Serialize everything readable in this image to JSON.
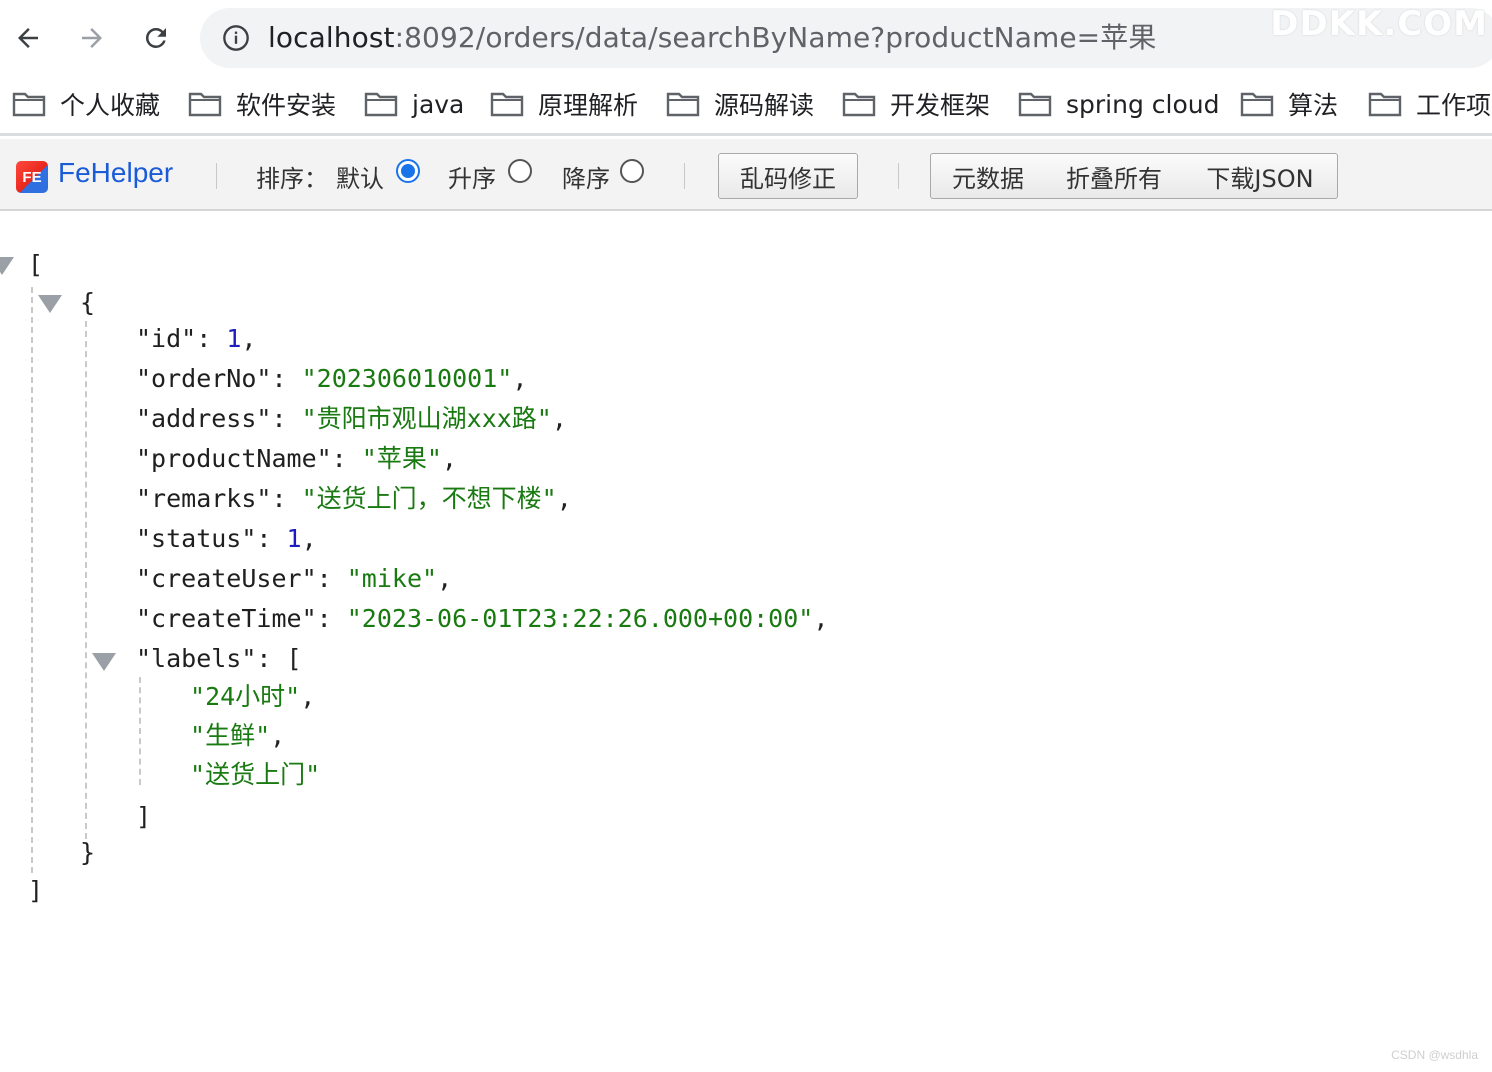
{
  "browser": {
    "url_host": "localhost",
    "url_rest": ":8092/orders/data/searchByName?productName=苹果",
    "watermark": "DDKK.COM"
  },
  "bookmarks": [
    "个人收藏",
    "软件安装",
    "java",
    "原理解析",
    "源码解读",
    "开发框架",
    "spring cloud",
    "算法",
    "工作项"
  ],
  "fehelper": {
    "logo": "FE",
    "title": "FeHelper",
    "sort_label": "排序：",
    "sort_default": "默认",
    "sort_asc": "升序",
    "sort_desc": "降序",
    "sort_selected": "默认",
    "fix_encoding": "乱码修正",
    "metadata": "元数据",
    "collapse_all": "折叠所有",
    "download_json": "下载JSON"
  },
  "json_result": [
    {
      "id": 1,
      "orderNo": "202306010001",
      "address": "贵阳市观山湖xxx路",
      "productName": "苹果",
      "remarks": "送货上门，不想下楼",
      "status": 1,
      "createUser": "mike",
      "createTime": "2023-06-01T23:22:26.000+00:00",
      "labels": [
        "24小时",
        "生鲜",
        "送货上门"
      ]
    }
  ],
  "footer_mark": "CSDN @wsdhla"
}
